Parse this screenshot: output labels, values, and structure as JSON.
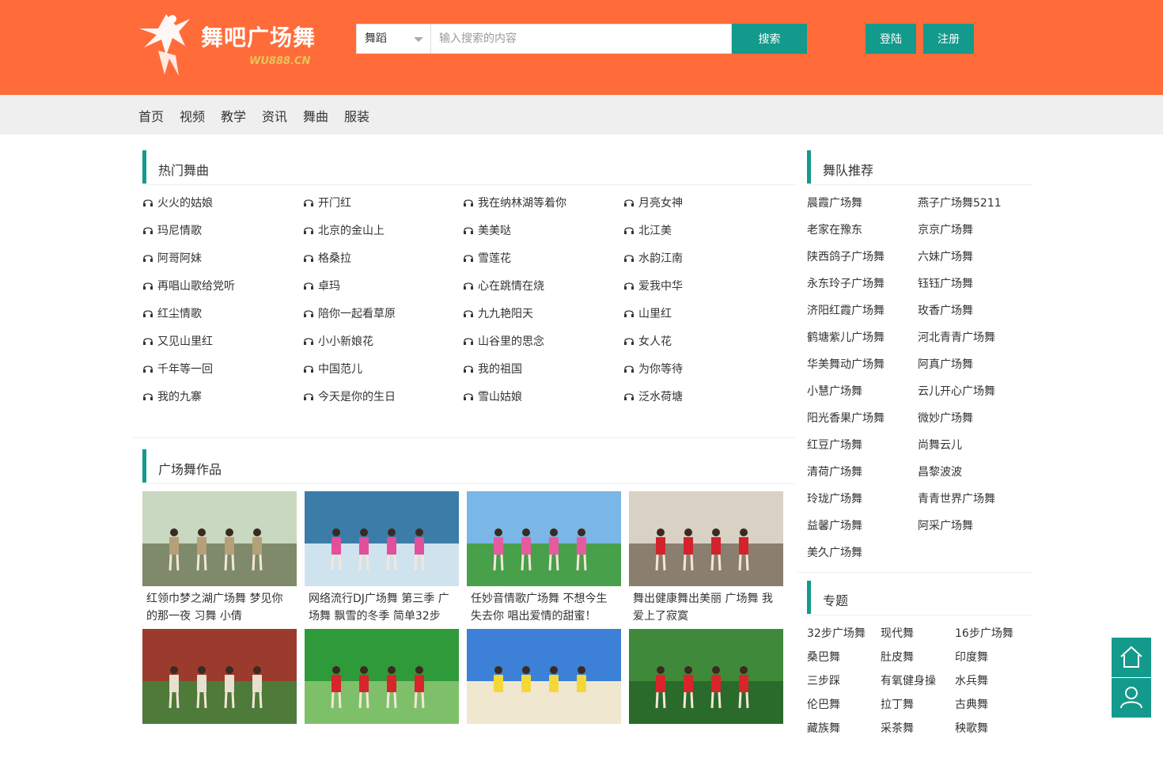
{
  "header": {
    "logo_text": "舞吧广场舞",
    "logo_sub": "WU888.CN",
    "search_select": "舞蹈",
    "search_placeholder": "输入搜索的内容",
    "search_button": "搜索",
    "login": "登陆",
    "register": "注册"
  },
  "nav": [
    "首页",
    "视频",
    "教学",
    "资讯",
    "舞曲",
    "服装"
  ],
  "hot_songs": {
    "title": "热门舞曲",
    "items": [
      "火火的姑娘",
      "开门红",
      "我在纳林湖等着你",
      "月亮女神",
      "玛尼情歌",
      "北京的金山上",
      "美美哒",
      "北江美",
      "阿哥阿妹",
      "格桑拉",
      "雪莲花",
      "水韵江南",
      "再唱山歌给党听",
      "卓玛",
      "心在跳情在烧",
      "爱我中华",
      "红尘情歌",
      "陪你一起看草原",
      "九九艳阳天",
      "山里红",
      "又见山里红",
      "小小新娘花",
      "山谷里的思念",
      "女人花",
      "千年等一回",
      "中国范儿",
      "我的祖国",
      "为你等待",
      "我的九寨",
      "今天是你的生日",
      "雪山姑娘",
      "泛水荷塘"
    ]
  },
  "works": {
    "title": "广场舞作品",
    "items": [
      {
        "caption": "红领巾梦之湖广场舞 梦见你的那一夜 习舞 小倩"
      },
      {
        "caption": "网络流行DJ广场舞 第三季 广场舞 飘雪的冬季 简单32步 动"
      },
      {
        "caption": "任妙音情歌广场舞 不想今生失去你 唱出爱情的甜蜜！"
      },
      {
        "caption": "舞出健康舞出美丽 广场舞 我爱上了寂寞"
      },
      {
        "caption": ""
      },
      {
        "caption": ""
      },
      {
        "caption": ""
      },
      {
        "caption": ""
      }
    ]
  },
  "teams": {
    "title": "舞队推荐",
    "items": [
      "晨霞广场舞",
      "燕子广场舞5211",
      "老家在豫东",
      "京京广场舞",
      "陕西鸽子广场舞",
      "六妹广场舞",
      "永东玲子广场舞",
      "钰钰广场舞",
      "济阳红霞广场舞",
      "玫香广场舞",
      "鹤塘紫儿广场舞",
      "河北青青广场舞",
      "华美舞动广场舞",
      "阿真广场舞",
      "小慧广场舞",
      "云儿开心广场舞",
      "阳光香果广场舞",
      "微妙广场舞",
      "红豆广场舞",
      "尚舞云儿",
      "清荷广场舞",
      "昌黎波波",
      "玲珑广场舞",
      "青青世界广场舞",
      "益馨广场舞",
      "阿采广场舞",
      "美久广场舞"
    ]
  },
  "topics": {
    "title": "专题",
    "items": [
      "32步广场舞",
      "现代舞",
      "16步广场舞",
      "桑巴舞",
      "肚皮舞",
      "印度舞",
      "三步踩",
      "有氧健身操",
      "水兵舞",
      "伦巴舞",
      "拉丁舞",
      "古典舞",
      "藏族舞",
      "采茶舞",
      "秧歌舞"
    ]
  },
  "colors": {
    "header": "#ff6c3a",
    "accent": "#139a8c"
  }
}
